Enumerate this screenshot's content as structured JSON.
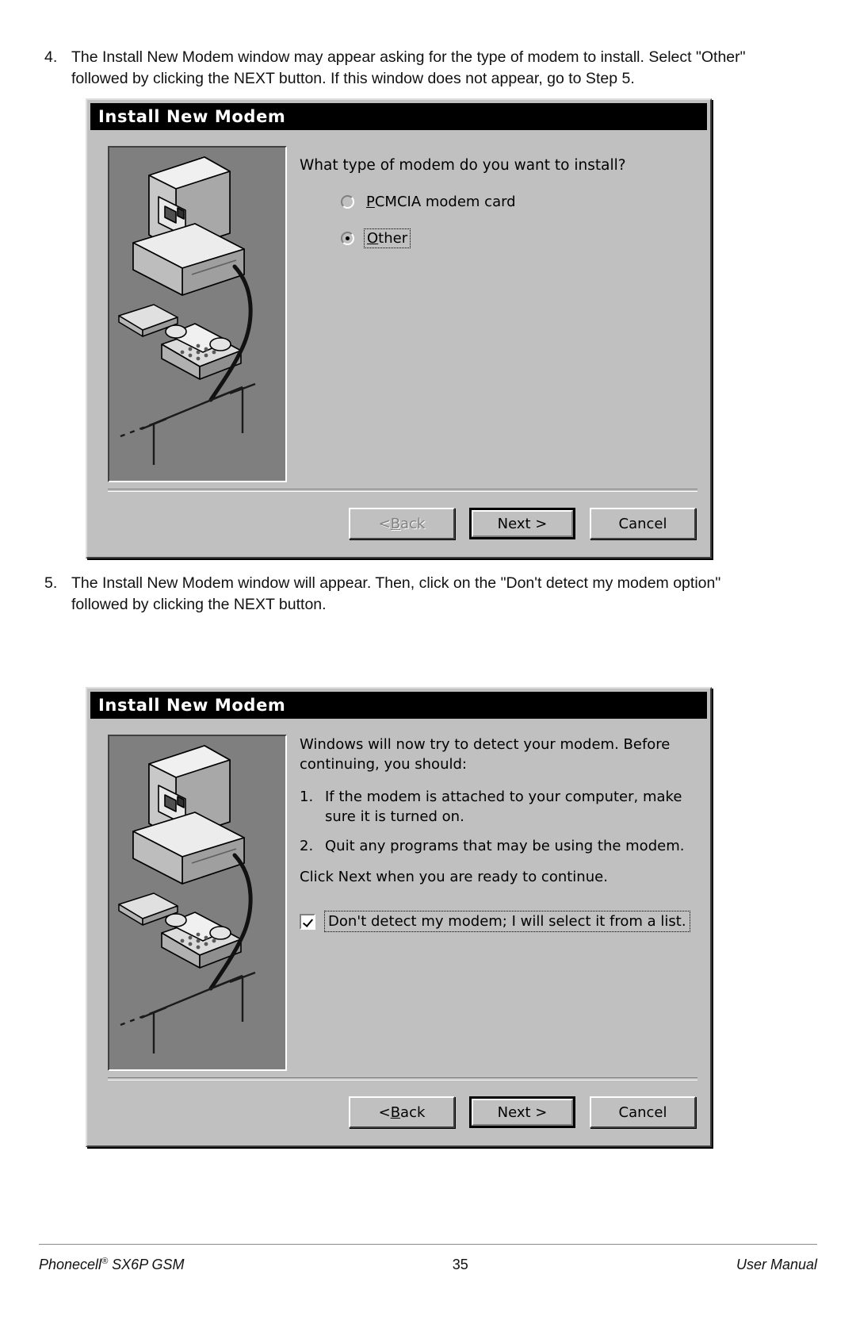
{
  "page": {
    "steps": [
      {
        "number": "4.",
        "text": "The Install New Modem window may appear asking for the type of modem to install. Select \"Other\" followed by clicking the NEXT button. If this window does not appear, go to Step 5."
      },
      {
        "number": "5.",
        "text": "The Install New Modem window will appear. Then, click on the \"Don't detect my modem option\" followed by clicking the NEXT button."
      }
    ]
  },
  "dialog1": {
    "title": "Install New Modem",
    "prompt": "What type of modem do you want to install?",
    "options": [
      {
        "accel": "P",
        "rest": "CMCIA modem card",
        "selected": false,
        "focused": false
      },
      {
        "accel": "O",
        "rest": "ther",
        "selected": true,
        "focused": true
      }
    ],
    "buttons": [
      {
        "name": "back",
        "pre": "< ",
        "accel": "B",
        "post": "ack",
        "state": "disabled"
      },
      {
        "name": "next",
        "pre": "",
        "accel": "",
        "post": "Next >",
        "state": "default"
      },
      {
        "name": "cancel",
        "pre": "",
        "accel": "",
        "post": "Cancel",
        "state": "normal"
      }
    ]
  },
  "dialog2": {
    "title": "Install New Modem",
    "intro": "Windows will now try to detect your modem.  Before continuing, you should:",
    "list": [
      {
        "n": "1.",
        "t": "If the modem is attached to your computer, make sure it is turned on."
      },
      {
        "n": "2.",
        "t": "Quit any programs that may be using the modem."
      }
    ],
    "outro": "Click Next when you are ready to continue.",
    "checkbox": {
      "label": "Don't detect my modem; I will select it from a list.",
      "checked": true,
      "focused": true
    },
    "buttons": [
      {
        "name": "back",
        "pre": "< ",
        "accel": "B",
        "post": "ack",
        "state": "normal"
      },
      {
        "name": "next",
        "pre": "",
        "accel": "",
        "post": "Next >",
        "state": "default"
      },
      {
        "name": "cancel",
        "pre": "",
        "accel": "",
        "post": "Cancel",
        "state": "normal"
      }
    ]
  },
  "footer": {
    "left_product": "Phonecell",
    "left_reg": "®",
    "left_model": " SX6P GSM",
    "page_number": "35",
    "right": "User Manual"
  },
  "colors": {
    "dialog_face": "#c0c0c0",
    "titlebar": "#000000",
    "titlebar_text": "#ffffff",
    "illustration_bg": "#7f7f7f"
  }
}
